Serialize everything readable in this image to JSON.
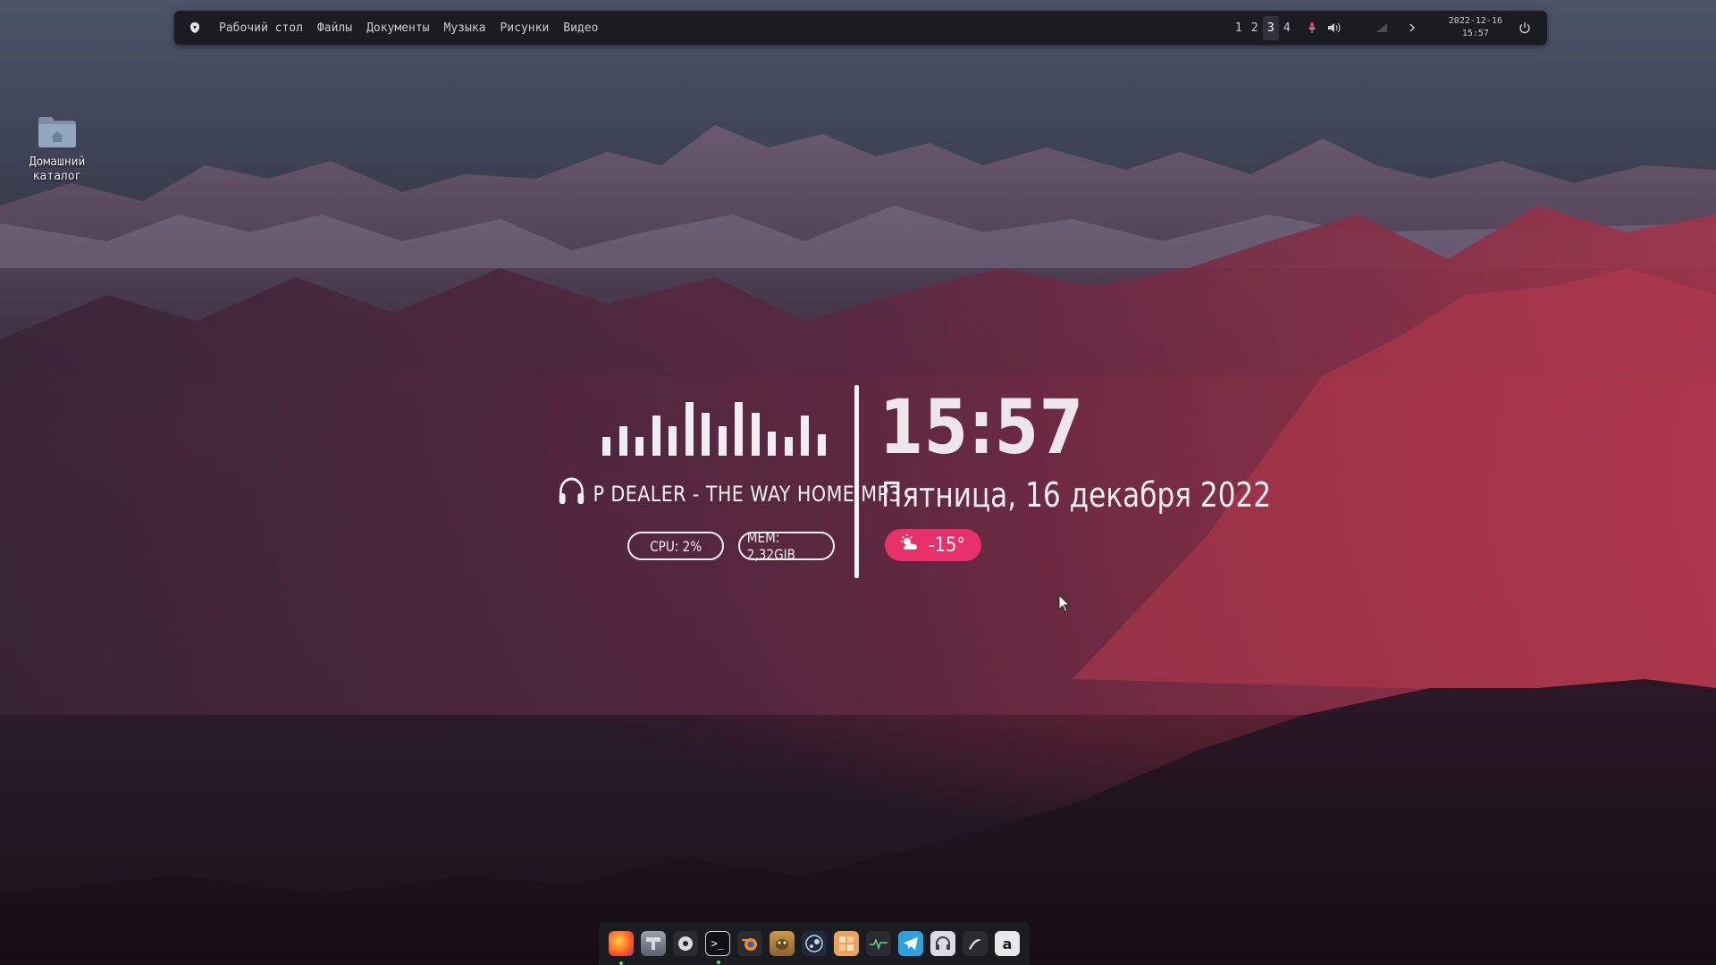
{
  "topbar": {
    "menu": [
      "Рабочий стол",
      "Файлы",
      "Документы",
      "Музыка",
      "Рисунки",
      "Видео"
    ],
    "workspaces": [
      "1",
      "2",
      "3",
      "4"
    ],
    "active_workspace": "3",
    "date": "2022-12-16",
    "time": "15:57",
    "icons": [
      "distro-logo-icon",
      "microphone-icon",
      "volume-icon",
      "network-icon",
      "chevron-right-icon",
      "power-icon"
    ]
  },
  "desktop": {
    "home_folder_label_line1": "Домашний",
    "home_folder_label_line2": "каталог"
  },
  "widget": {
    "track": "P DEALER - THE WAY HOME.MP3",
    "cpu": "CPU: 2%",
    "mem": "MEM: 2,32GIB",
    "time": "15:57",
    "date": "Пятница, 16 декабря 2022",
    "weather_temp": "-15°",
    "weather_icon": "sun-behind-cloud-icon",
    "equalizer_levels": [
      0.35,
      0.55,
      0.35,
      0.75,
      0.55,
      1.0,
      0.8,
      0.55,
      1.0,
      0.8,
      0.45,
      0.35,
      0.75,
      0.4
    ],
    "accent_color": "#e8306a"
  },
  "dock": {
    "apps": [
      "firefox",
      "disk-utility",
      "system-settings",
      "terminal",
      "blender",
      "gimp",
      "steam",
      "file-manager",
      "system-monitor",
      "telegram",
      "music-player",
      "inkscape",
      "appstore"
    ]
  }
}
